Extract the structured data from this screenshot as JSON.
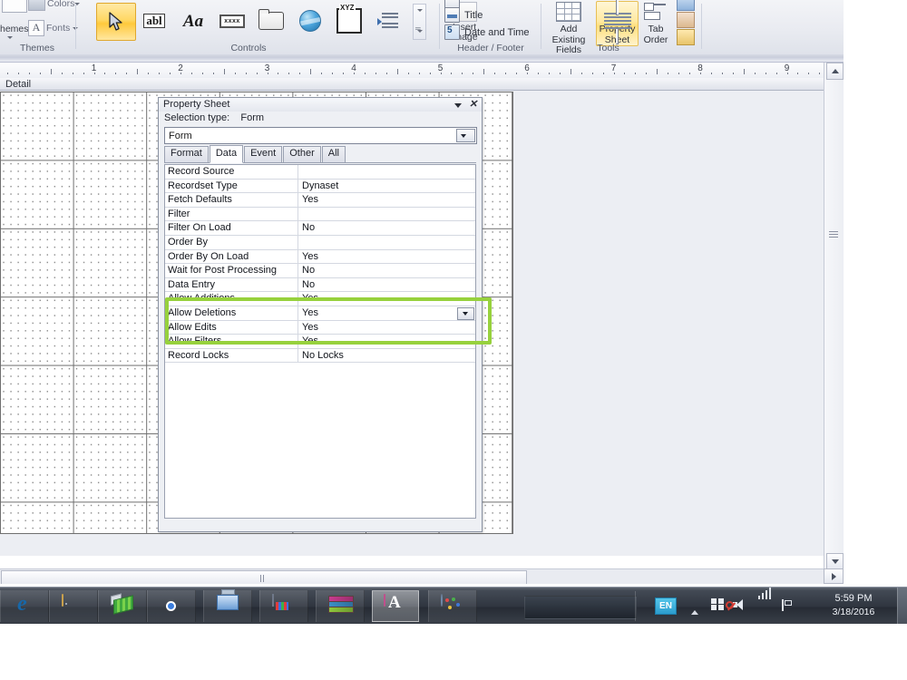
{
  "ribbon": {
    "groups": [
      {
        "name": "Themes",
        "label": "Themes"
      },
      {
        "name": "Controls",
        "label": "Controls"
      },
      {
        "name": "HeaderFooter",
        "label": "Header / Footer"
      },
      {
        "name": "Tools",
        "label": "Tools"
      }
    ],
    "themes": {
      "colors_label": "Colors",
      "fonts_label": "Fonts",
      "themes_label": "hemes"
    },
    "controls": {
      "items": [
        {
          "icon": "select-pointer-icon",
          "label": "Select",
          "selected": true
        },
        {
          "icon": "text-box-icon",
          "label": "Text Box",
          "glyph": "abl"
        },
        {
          "icon": "label-icon",
          "label": "Label",
          "glyph": "Aa"
        },
        {
          "icon": "button-icon",
          "label": "Button",
          "glyph": "xxxx"
        },
        {
          "icon": "tab-control-icon",
          "label": "Tab Control"
        },
        {
          "icon": "hyperlink-icon",
          "label": "Hyperlink"
        },
        {
          "icon": "web-browser-control-icon",
          "label": "Web Browser Control",
          "glyph": "XYZ"
        },
        {
          "icon": "navigation-control-icon",
          "label": "Navigation Control"
        }
      ],
      "more_label": "More"
    },
    "insert_image": {
      "line1": "Insert",
      "line2": "Image"
    },
    "header_footer": {
      "items": [
        {
          "icon": "logo-icon",
          "label": ""
        },
        {
          "icon": "title-icon",
          "label": "Title"
        },
        {
          "icon": "date-time-icon",
          "label": "Date and Time"
        }
      ]
    },
    "tools": {
      "add_existing_fields": {
        "line1": "Add Existing",
        "line2": "Fields"
      },
      "property_sheet": {
        "line1": "Property",
        "line2": "Sheet",
        "active": true
      },
      "tab_order": {
        "line1": "Tab",
        "line2": "Order"
      },
      "extras": [
        "subform-in-new-window-icon",
        "view-code-icon",
        "convert-macros-icon"
      ]
    }
  },
  "ruler": {
    "unit": "inches",
    "numbers": [
      "1",
      "2",
      "3",
      "4",
      "5",
      "6",
      "7",
      "8",
      "9"
    ]
  },
  "design": {
    "section_label": "Detail"
  },
  "property_sheet": {
    "title": "Property Sheet",
    "selection_type_label": "Selection type:",
    "selection_type_value": "Form",
    "object_selector_value": "Form",
    "tabs": [
      {
        "label": "Format",
        "selected": false
      },
      {
        "label": "Data",
        "selected": true
      },
      {
        "label": "Event",
        "selected": false
      },
      {
        "label": "Other",
        "selected": false
      },
      {
        "label": "All",
        "selected": false
      }
    ],
    "properties": [
      {
        "name": "Record Source",
        "value": ""
      },
      {
        "name": "Recordset Type",
        "value": "Dynaset"
      },
      {
        "name": "Fetch Defaults",
        "value": "Yes"
      },
      {
        "name": "Filter",
        "value": ""
      },
      {
        "name": "Filter On Load",
        "value": "No"
      },
      {
        "name": "Order By",
        "value": ""
      },
      {
        "name": "Order By On Load",
        "value": "Yes"
      },
      {
        "name": "Wait for Post Processing",
        "value": "No"
      },
      {
        "name": "Data Entry",
        "value": "No"
      },
      {
        "name": "Allow Additions",
        "value": "Yes",
        "highlighted": true
      },
      {
        "name": "Allow Deletions",
        "value": "Yes",
        "highlighted": true,
        "has_dropdown": true
      },
      {
        "name": "Allow Edits",
        "value": "Yes",
        "highlighted": true
      },
      {
        "name": "Allow Filters",
        "value": "Yes"
      },
      {
        "name": "Record Locks",
        "value": "No Locks"
      }
    ],
    "close_icon": "close-icon",
    "collapse_icon": "chevron-down-icon",
    "highlight_color": "#97d13d"
  },
  "taskbar": {
    "items": [
      {
        "name": "internet-explorer",
        "icon": "internet-explorer-icon"
      },
      {
        "name": "file-explorer",
        "icon": "folder-icon"
      },
      {
        "name": "diagram-app",
        "icon": "diagram-icon"
      },
      {
        "name": "google-chrome",
        "icon": "chrome-icon"
      },
      {
        "name": "remote-desktop",
        "icon": "remote-desktop-icon"
      },
      {
        "name": "document",
        "icon": "document-icon"
      },
      {
        "name": "winrar",
        "icon": "winrar-icon"
      },
      {
        "name": "microsoft-access",
        "icon": "access-icon"
      },
      {
        "name": "paint",
        "icon": "paint-icon"
      }
    ],
    "tray": {
      "language": "EN",
      "icons": [
        "show-hidden-icons-arrow",
        "windows-flag-icon",
        "speaker-muted-icon",
        "signal-bars-icon",
        "action-center-flag-icon"
      ],
      "time": "5:59 PM",
      "date": "3/18/2016"
    }
  }
}
